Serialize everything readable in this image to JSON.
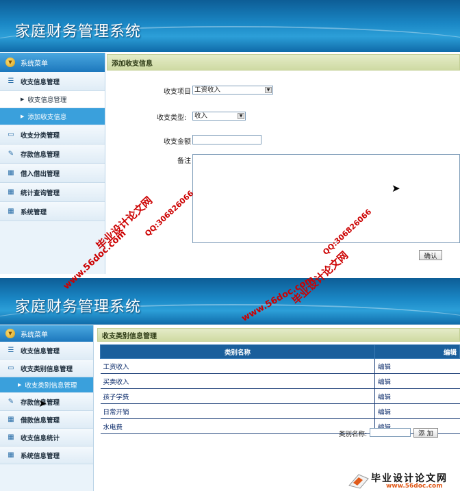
{
  "app_title": "家庭财务管理系统",
  "screen1": {
    "menu_title": "系统菜单",
    "menu": [
      {
        "label": "收支信息管理",
        "icon": "list-icon"
      },
      {
        "label": "收支信息管理",
        "sub": true
      },
      {
        "label": "添加收支信息",
        "sub": true,
        "active": true
      },
      {
        "label": "收支分类管理",
        "icon": "chat-icon"
      },
      {
        "label": "存款信息管理",
        "icon": "edit-icon"
      },
      {
        "label": "借入借出管理",
        "icon": "calendar-icon"
      },
      {
        "label": "统计查询管理",
        "icon": "calendar-icon"
      },
      {
        "label": "系统管理",
        "icon": "calendar-icon"
      }
    ],
    "panel_title": "添加收支信息",
    "form": {
      "item_label": "收支项目",
      "item_value": "工资收入",
      "type_label": "收支类型:",
      "type_value": "收入",
      "amount_label": "收支金额",
      "amount_value": "",
      "note_label": "备注",
      "note_value": "",
      "confirm_label": "确认"
    }
  },
  "screen2": {
    "menu_title": "系统菜单",
    "menu": [
      {
        "label": "收支信息管理",
        "icon": "list-icon"
      },
      {
        "label": "收支类别信息管理",
        "icon": "chat-icon"
      },
      {
        "label": "收支类别信息管理",
        "sub": true,
        "active": true
      },
      {
        "label": "存款信息管理",
        "icon": "edit-icon"
      },
      {
        "label": "借款信息管理",
        "icon": "calendar-icon"
      },
      {
        "label": "收支信息统计",
        "icon": "calendar-icon"
      },
      {
        "label": "系统信息管理",
        "icon": "calendar-icon"
      }
    ],
    "panel_title": "收支类别信息管理",
    "table": {
      "headers": [
        "类别名称",
        "编辑"
      ],
      "rows": [
        {
          "name": "工资收入",
          "edit": "编辑"
        },
        {
          "name": "买卖收入",
          "edit": "编辑"
        },
        {
          "name": "孩子学费",
          "edit": "编辑"
        },
        {
          "name": "日常开销",
          "edit": "编辑"
        },
        {
          "name": "水电费",
          "edit": "编辑"
        }
      ]
    },
    "add_label": "类别名称:",
    "add_value": "",
    "add_button": "添 加"
  },
  "watermarks": {
    "site_cn": "毕业设计论文网",
    "site_url": "www.56doc.com",
    "qq": "QQ:306826066"
  },
  "logo": {
    "text": "毕业设计论文网",
    "url": "www.56doc.com"
  }
}
